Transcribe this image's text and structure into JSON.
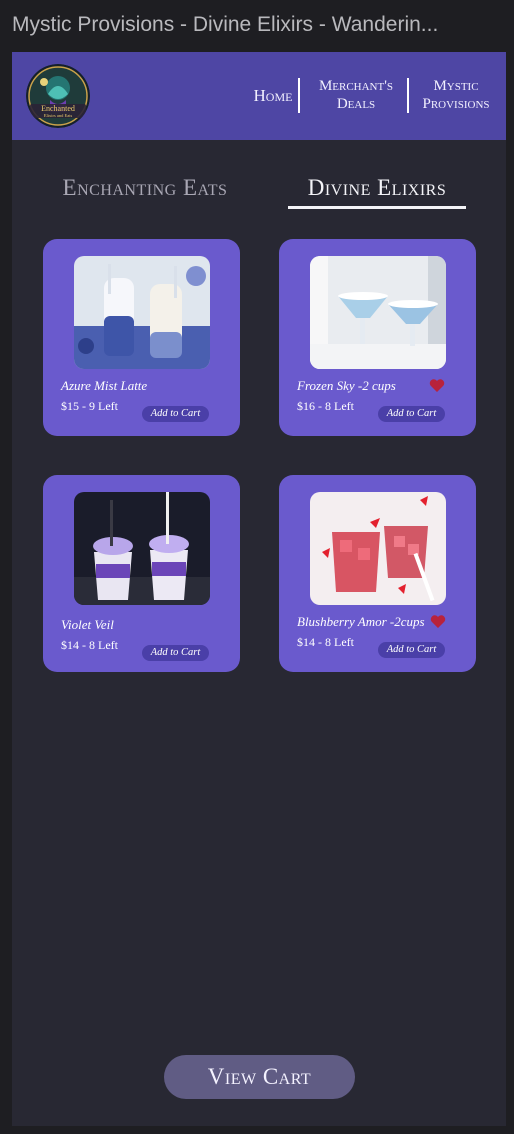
{
  "window": {
    "title": "Mystic Provisions - Divine Elixirs - Wanderin..."
  },
  "navbar": {
    "logo_text": [
      "Enchanted",
      "Elixirs and Eats"
    ],
    "home": "Home",
    "merchants": [
      "Merchant's",
      "Deals"
    ],
    "mystic": [
      "Mystic",
      "Provisions"
    ]
  },
  "tabs": {
    "eats": "Enchanting Eats",
    "elixirs": "Divine Elixirs",
    "active": "elixirs"
  },
  "products": [
    {
      "name": "Azure Mist Latte",
      "price": "$15  -  9 Left",
      "add": "Add to Cart",
      "favorite": false
    },
    {
      "name": "Frozen Sky -2 cups",
      "price": "$16  -  8 Left",
      "add": "Add to Cart",
      "favorite": true
    },
    {
      "name": "Violet Veil",
      "price": "$14   -  8 Left",
      "add": "Add to Cart",
      "favorite": false
    },
    {
      "name": "Blushberry Amor -2cups",
      "price": "$14  -  8 Left",
      "add": "Add to Cart",
      "favorite": true
    }
  ],
  "cart": {
    "label": "View Cart"
  },
  "colors": {
    "nav": "#4e46a4",
    "card": "#6a5acd",
    "button": "#4a3fa8",
    "heart": "#b8223c",
    "page": "#282833"
  }
}
